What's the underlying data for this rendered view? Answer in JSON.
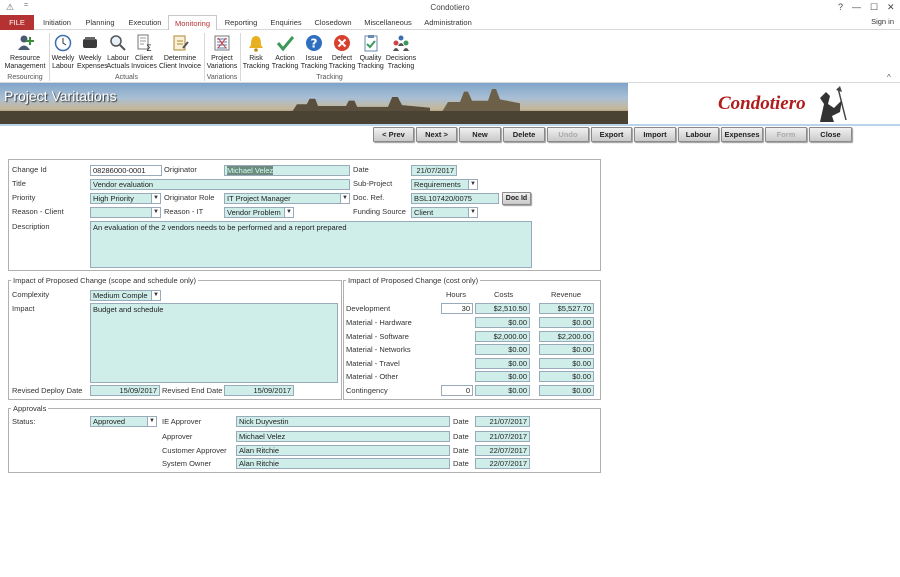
{
  "app": {
    "title": "Condotiero",
    "sign_in": "Sign in"
  },
  "menu": {
    "file": "FILE",
    "tabs": [
      "Initiation",
      "Planning",
      "Execution",
      "Monitoring",
      "Reporting",
      "Enquiries",
      "Closedown",
      "Miscellaneous",
      "Administration"
    ],
    "active": "Monitoring"
  },
  "ribbon": {
    "buttons": [
      {
        "label1": "Resource",
        "label2": "Management",
        "icon": "user-add-icon"
      },
      {
        "label1": "Weekly",
        "label2": "Labour",
        "icon": "clock-icon"
      },
      {
        "label1": "Weekly",
        "label2": "Expenses",
        "icon": "wallet-icon"
      },
      {
        "label1": "Labour",
        "label2": "Actuals",
        "icon": "magnifier-icon"
      },
      {
        "label1": "Client",
        "label2": "Invoices",
        "icon": "invoice-sum-icon"
      },
      {
        "label1": "Determine",
        "label2": "Client Invoice",
        "icon": "invoice-edit-icon"
      },
      {
        "label1": "Project",
        "label2": "Variations",
        "icon": "variations-icon"
      },
      {
        "label1": "Risk",
        "label2": "Tracking",
        "icon": "bell-icon"
      },
      {
        "label1": "Action",
        "label2": "Tracking",
        "icon": "checkmark-icon"
      },
      {
        "label1": "Issue",
        "label2": "Tracking",
        "icon": "question-icon"
      },
      {
        "label1": "Defect",
        "label2": "Tracking",
        "icon": "error-icon"
      },
      {
        "label1": "Quality",
        "label2": "Tracking",
        "icon": "clipboard-check-icon"
      },
      {
        "label1": "Decisions",
        "label2": "Tracking",
        "icon": "people-icon"
      }
    ],
    "groups": [
      "Resourcing",
      "Actuals",
      "Variations",
      "Tracking"
    ]
  },
  "banner": {
    "page_title": "Project Varitations",
    "brand": "Condotiero"
  },
  "toolbar": [
    "< Prev",
    "Next >",
    "New",
    "Delete",
    "Undo",
    "Export",
    "Import",
    "Labour",
    "Expenses",
    "Form",
    "Close"
  ],
  "toolbar_disabled": [
    "Undo",
    "Form"
  ],
  "form": {
    "change_id_label": "Change Id",
    "change_id": "08286000-0001",
    "originator_label": "Originator",
    "originator": "Michael Velez",
    "date_label": "Date",
    "date": "21/07/2017",
    "title_label": "Title",
    "title": "Vendor evaluation",
    "subproject_label": "Sub-Project",
    "subproject": "Requirements",
    "priority_label": "Priority",
    "priority": "High Priority",
    "orig_role_label": "Originator Role",
    "orig_role": "IT Project Manager",
    "docref_label": "Doc. Ref.",
    "docref": "BSL107420/0075",
    "docid_btn": "Doc Id",
    "reason_client_label": "Reason - Client",
    "reason_client": "",
    "reason_it_label": "Reason - IT",
    "reason_it": "Vendor Problem",
    "funding_label": "Funding Source",
    "funding": "Client",
    "description_label": "Description",
    "description": "An evaluation of the 2 vendors needs to be performed and a report prepared"
  },
  "scope": {
    "legend": "Impact of Proposed Change (scope and schedule only)",
    "complexity_label": "Complexity",
    "complexity": "Medium Comple",
    "impact_label": "Impact",
    "impact": "Budget and schedule",
    "deploy_label": "Revised Deploy Date",
    "deploy": "15/09/2017",
    "end_label": "Revised End Date",
    "end": "15/09/2017"
  },
  "cost": {
    "legend": "Impact of Proposed Change (cost only)",
    "headers": [
      "Hours",
      "Costs",
      "Revenue"
    ],
    "rows": [
      {
        "label": "Development",
        "hours": "30",
        "cost": "$2,510.50",
        "revenue": "$5,527.70"
      },
      {
        "label": "Material - Hardware",
        "hours": "",
        "cost": "$0.00",
        "revenue": "$0.00"
      },
      {
        "label": "Material - Software",
        "hours": "",
        "cost": "$2,000.00",
        "revenue": "$2,200.00"
      },
      {
        "label": "Material - Networks",
        "hours": "",
        "cost": "$0.00",
        "revenue": "$0.00"
      },
      {
        "label": "Material - Travel",
        "hours": "",
        "cost": "$0.00",
        "revenue": "$0.00"
      },
      {
        "label": "Material - Other",
        "hours": "",
        "cost": "$0.00",
        "revenue": "$0.00"
      },
      {
        "label": "Contingency",
        "hours": "0",
        "cost": "$0.00",
        "revenue": "$0.00"
      }
    ]
  },
  "approvals": {
    "legend": "Approvals",
    "status_label": "Status:",
    "status": "Approved",
    "date_label": "Date",
    "rows": [
      {
        "role": "IE Approver",
        "name": "Nick Duyvestin",
        "date": "21/07/2017"
      },
      {
        "role": "Approver",
        "name": "Michael Velez",
        "date": "21/07/2017"
      },
      {
        "role": "Customer Approver",
        "name": "Alan Ritchie",
        "date": "22/07/2017"
      },
      {
        "role": "System Owner",
        "name": "Alan Ritchie",
        "date": "22/07/2017"
      }
    ]
  },
  "colors": {
    "accent": "#b53232",
    "field": "#cfeee9",
    "brand": "#b01c1c"
  }
}
